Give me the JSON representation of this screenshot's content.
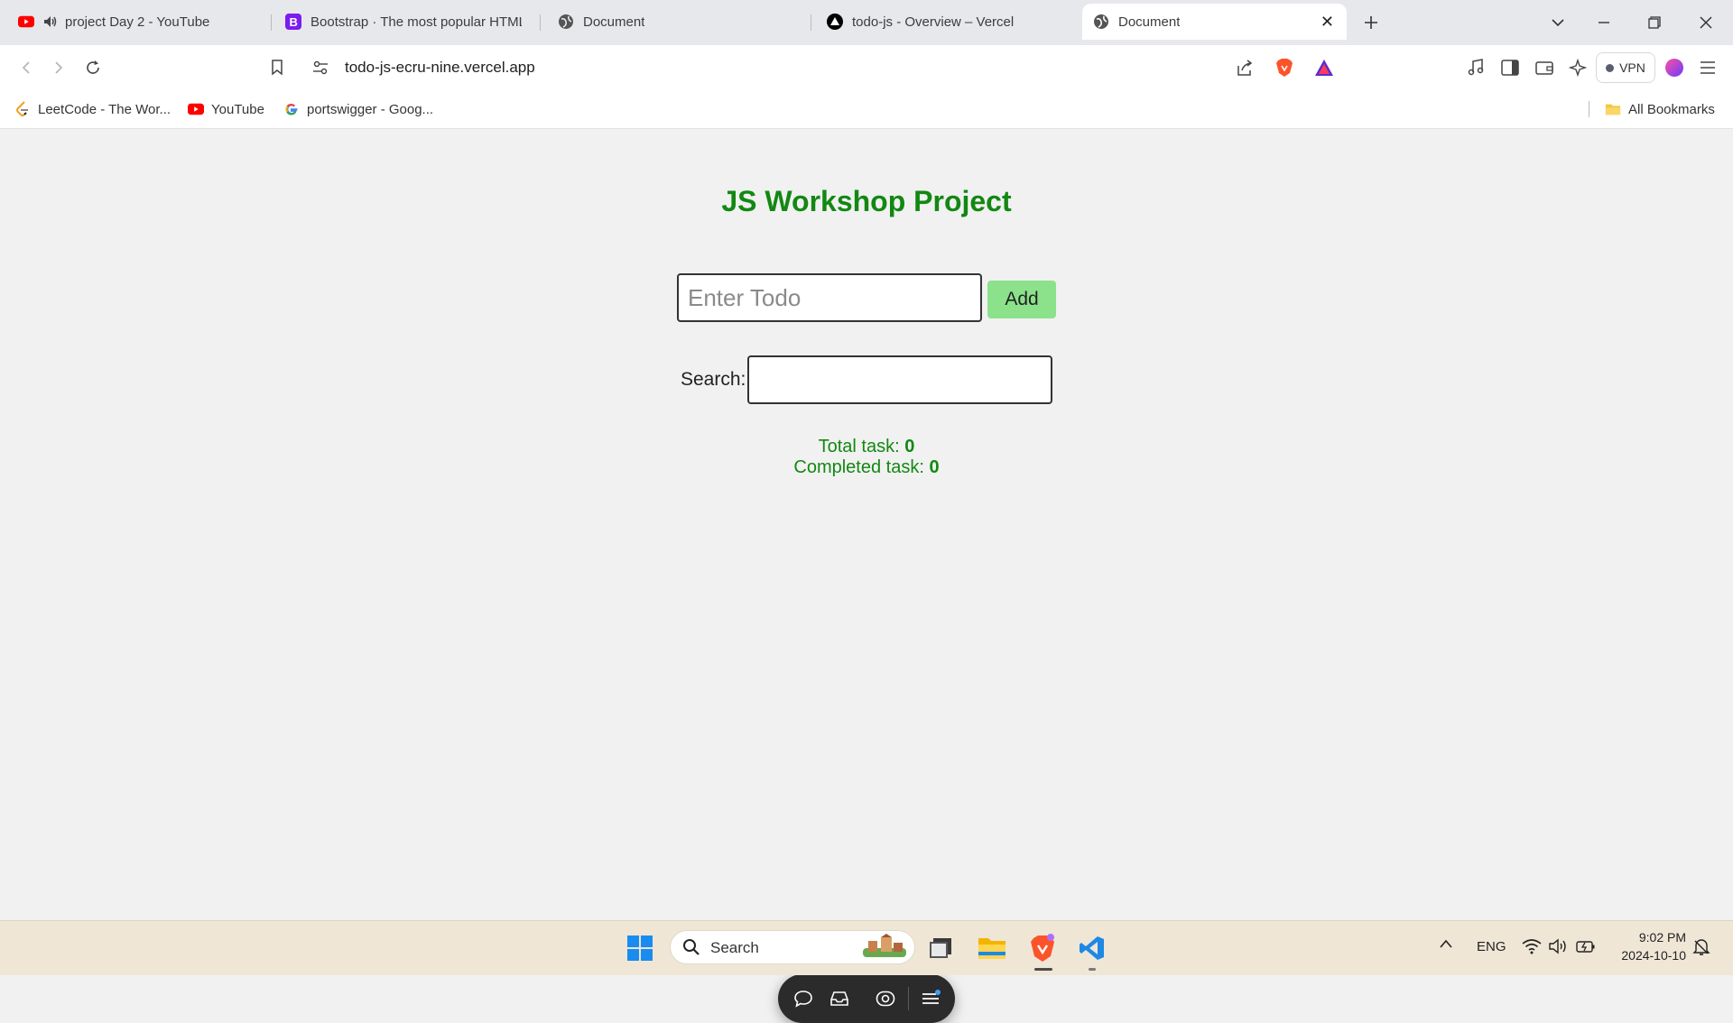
{
  "tabs": [
    {
      "title": "project Day 2 - YouTube",
      "icon": "youtube-icon",
      "audio": true
    },
    {
      "title": "Bootstrap · The most popular HTML",
      "icon": "bootstrap-icon"
    },
    {
      "title": "Document",
      "icon": "globe-icon"
    },
    {
      "title": "todo-js - Overview – Vercel",
      "icon": "vercel-icon"
    },
    {
      "title": "Document",
      "icon": "globe-icon",
      "active": true
    }
  ],
  "toolbar": {
    "url": "todo-js-ecru-nine.vercel.app",
    "vpn_label": "VPN"
  },
  "bookmarks": {
    "items": [
      {
        "label": "LeetCode - The Wor...",
        "icon": "leetcode-icon"
      },
      {
        "label": "YouTube",
        "icon": "youtube-icon"
      },
      {
        "label": "portswigger - Goog...",
        "icon": "google-icon"
      }
    ],
    "all_label": "All Bookmarks"
  },
  "page": {
    "title": "JS Workshop Project",
    "todo_placeholder": "Enter Todo",
    "add_label": "Add",
    "search_label": "Search:",
    "total_label": "Total task: ",
    "total_value": "0",
    "completed_label": "Completed task: ",
    "completed_value": "0"
  },
  "taskbar": {
    "search_label": "Search",
    "lang": "ENG",
    "time": "9:02 PM",
    "date": "2024-10-10"
  },
  "colors": {
    "accent_green": "#128812",
    "add_button": "#8be28b",
    "brave_orange": "#fb542b"
  }
}
